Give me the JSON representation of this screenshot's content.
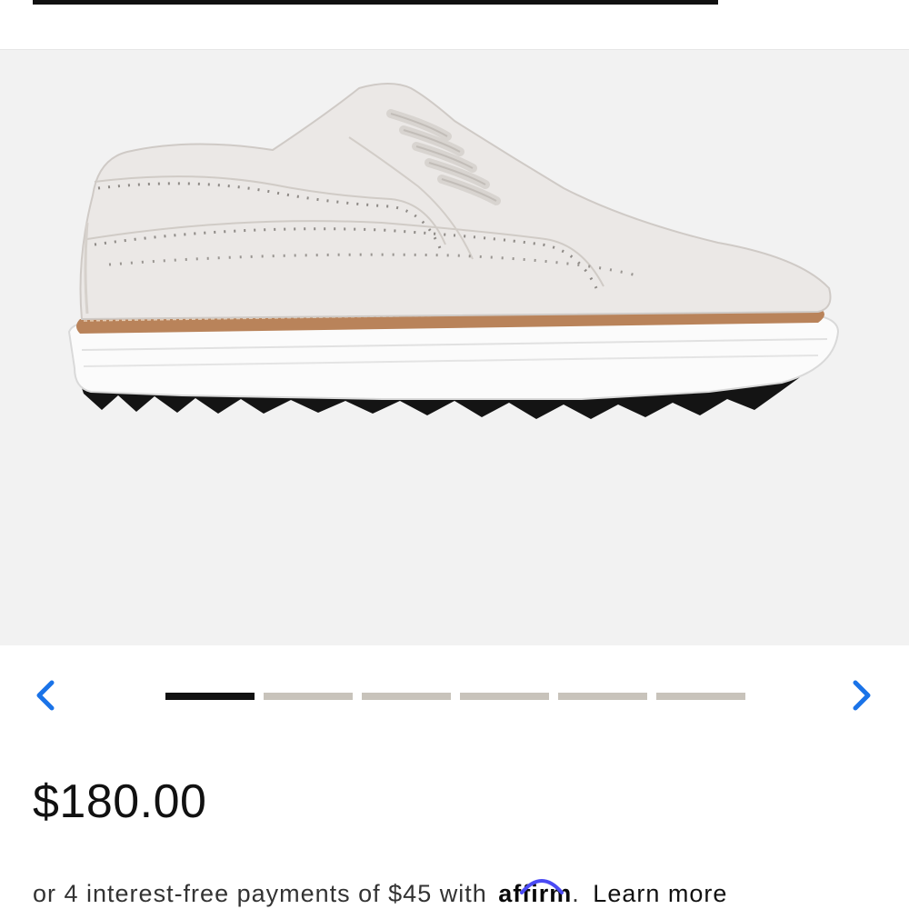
{
  "product": {
    "image_alt": "White wingtip golf shoe",
    "price": "$180.00"
  },
  "carousel": {
    "slide_count": 6,
    "active_index": 0,
    "prev_icon": "chevron-left-icon",
    "next_icon": "chevron-right-icon"
  },
  "installments": {
    "text": "or 4 interest-free payments of $45 with",
    "brand": "affirm",
    "suffix": ".",
    "link": "Learn more"
  },
  "colors": {
    "accent": "#1a73e8",
    "indicator_active": "#111111",
    "indicator_inactive": "#c8c3bb",
    "image_background": "#f2f2f2",
    "affirm_arc": "#4a4af4"
  }
}
